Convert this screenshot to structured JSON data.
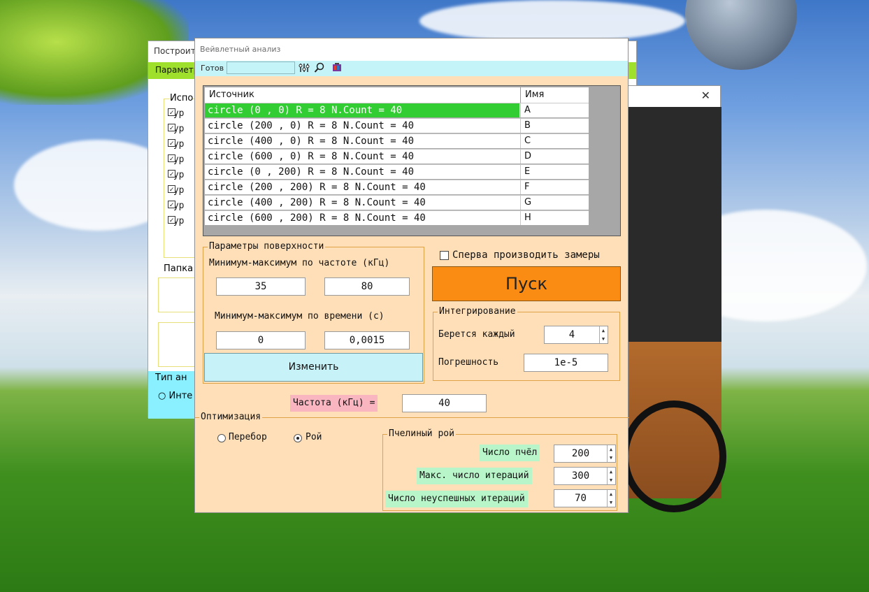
{
  "desktop": {},
  "back_window": {
    "title": "Построить",
    "tab": "Параметр",
    "group1_title": "Испо",
    "items": [
      "typ",
      "typ",
      "typ",
      "typ",
      "typ",
      "typ",
      "typ",
      "typ"
    ],
    "group2_title": "Папка",
    "type_title": "Тип ан",
    "radio_label": "Инте"
  },
  "image_window": {
    "close": "✕"
  },
  "main": {
    "title": "Вейвлетный анализ",
    "status_label": "Готов",
    "status_value": "",
    "toolbar_icons": [
      "settings-sliders-icon",
      "search-icon",
      "palette-icon"
    ],
    "grid": {
      "col_source": "Источник",
      "col_name": "Имя",
      "rows": [
        {
          "source": "circle (0 , 0) R = 8 N.Count = 40",
          "name": "A",
          "selected": true
        },
        {
          "source": "circle (200 , 0) R = 8 N.Count = 40",
          "name": "B",
          "selected": false
        },
        {
          "source": "circle (400 , 0) R = 8 N.Count = 40",
          "name": "C",
          "selected": false
        },
        {
          "source": "circle (600 , 0) R = 8 N.Count = 40",
          "name": "D",
          "selected": false
        },
        {
          "source": "circle (0 , 200) R = 8 N.Count = 40",
          "name": "E",
          "selected": false
        },
        {
          "source": "circle (200 , 200) R = 8 N.Count = 40",
          "name": "F",
          "selected": false
        },
        {
          "source": "circle (400 , 200) R = 8 N.Count = 40",
          "name": "G",
          "selected": false
        },
        {
          "source": "circle (600 , 200) R = 8 N.Count = 40",
          "name": "H",
          "selected": false
        }
      ]
    },
    "surface": {
      "title": "Параметры поверхности",
      "freq_label": "Минимум-максимум по частоте (кГц)",
      "freq_min": "35",
      "freq_max": "80",
      "time_label": "Минимум-максимум по времени (с)",
      "time_min": "0",
      "time_max": "0,0015",
      "change_button": "Изменить"
    },
    "measure_checkbox": "Сперва производить замеры",
    "start_button": "Пуск",
    "integration": {
      "title": "Интегрирование",
      "every_label": "Берется каждый",
      "every_value": "4",
      "error_label": "Погрешность",
      "error_value": "1e-5"
    },
    "frequency_label": "Частота (кГц) =",
    "frequency_value": "40",
    "optimization": {
      "title": "Оптимизация",
      "radio_bruteforce": "Перебор",
      "radio_swarm": "Рой",
      "selected": "Рой",
      "bees": {
        "title": "Пчелиный рой",
        "count_label": "Число пчёл",
        "count_value": "200",
        "max_iter_label": "Макс. число итераций",
        "max_iter_value": "300",
        "fail_iter_label": "Число неуспешных итераций",
        "fail_iter_value": "70"
      }
    }
  }
}
